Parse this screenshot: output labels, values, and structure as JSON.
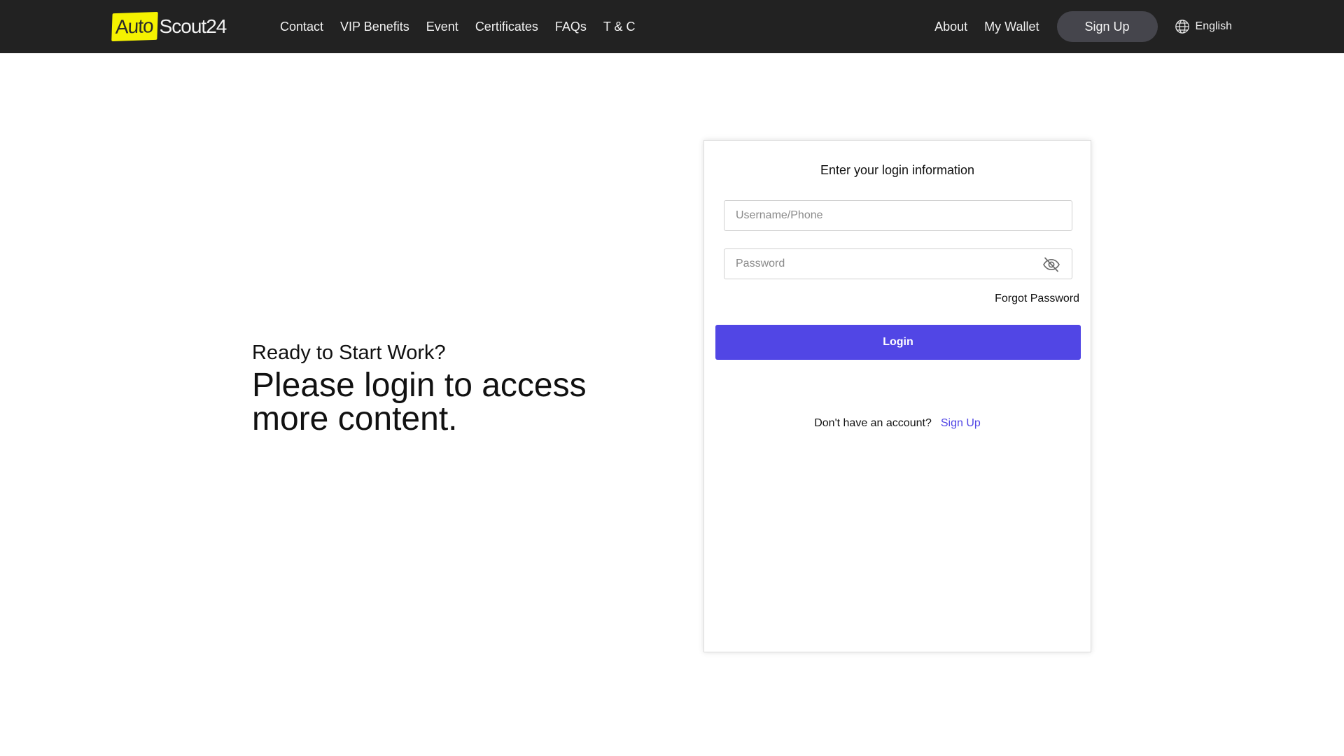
{
  "header": {
    "logo": {
      "part1": "Auto",
      "part2": "Scout24"
    },
    "nav_left": [
      "Contact",
      "VIP Benefits",
      "Event",
      "Certificates",
      "FAQs",
      "T & C"
    ],
    "about_label": "About",
    "wallet_label": "My Wallet",
    "signup_label": "Sign Up",
    "language_label": "English",
    "language_icon": "globe-icon"
  },
  "hero": {
    "kicker": "Ready to Start Work?",
    "title_line1": "Please login to access",
    "title_line2": "more content."
  },
  "login": {
    "title": "Enter your login information",
    "username_placeholder": "Username/Phone",
    "username_value": "",
    "password_placeholder": "Password",
    "password_value": "",
    "password_toggle_icon": "eye-off-icon",
    "forgot_label": "Forgot Password",
    "submit_label": "Login",
    "no_account_text": "Don't have an account?",
    "signup_link": "Sign Up"
  },
  "colors": {
    "topbar_bg": "#222222",
    "brand_yellow": "#f5f200",
    "accent": "#5146e5",
    "signup_pill_bg": "#45454c"
  }
}
